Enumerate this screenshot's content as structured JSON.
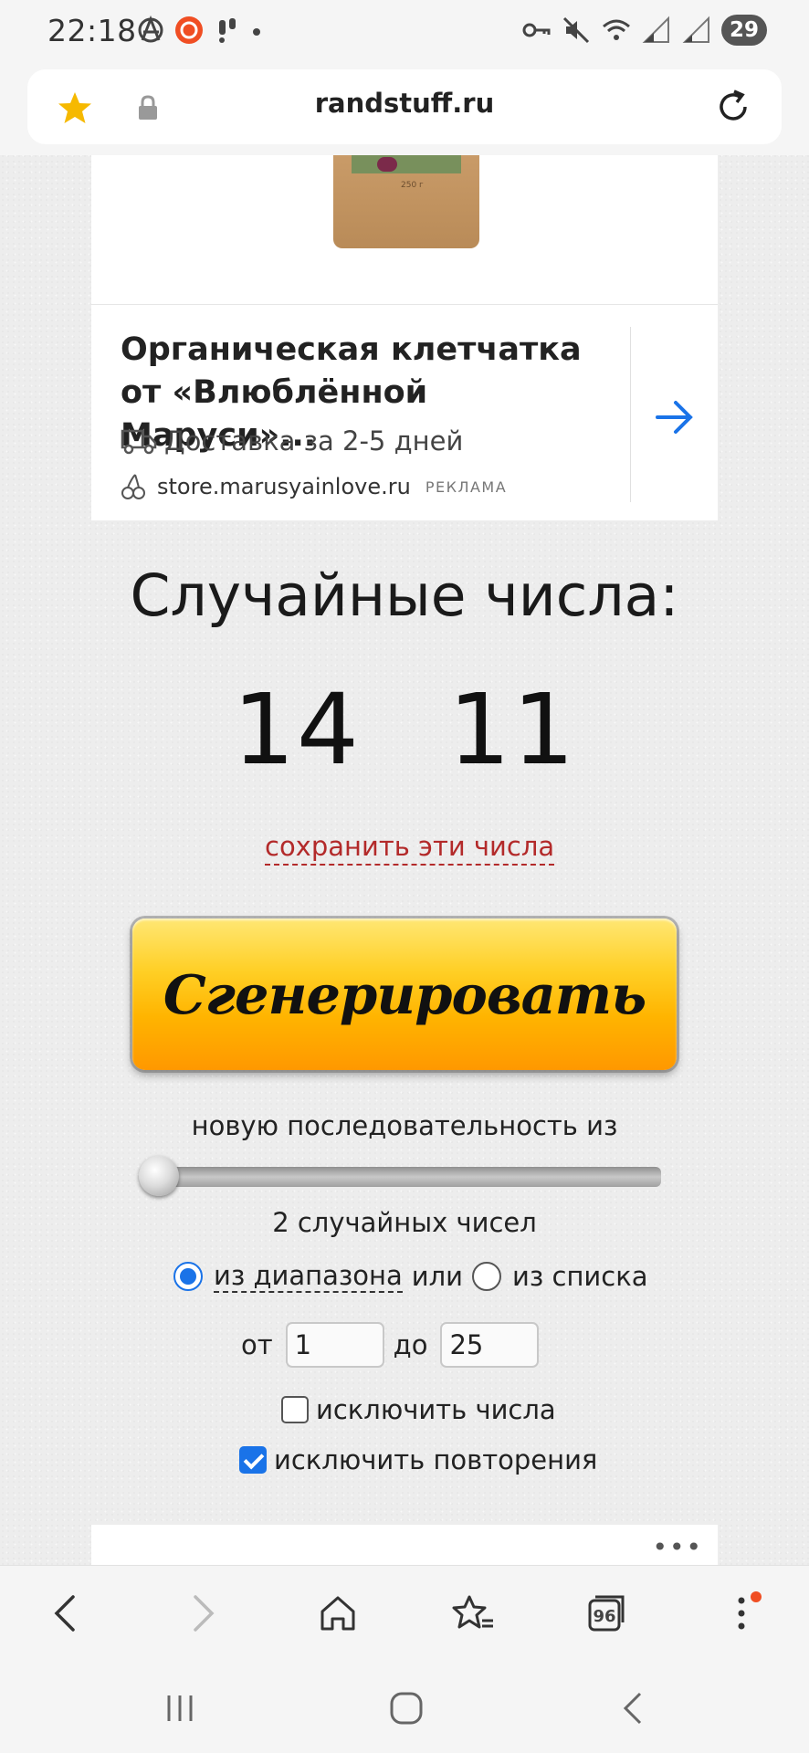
{
  "status_bar": {
    "time": "22:18",
    "battery": "29",
    "icons_left": [
      "anarchy-icon",
      "app-badge-icon",
      "notification-icon",
      "dot-icon"
    ],
    "icons_right": [
      "key-icon",
      "mute-icon",
      "wifi-icon",
      "signal-icon",
      "signal-icon",
      "battery-icon"
    ]
  },
  "browser": {
    "url": "randstuff.ru",
    "bookmarked": true,
    "tabs_count": "96"
  },
  "ad": {
    "title_line1": "Органическая клетчатка",
    "title_line2": "от «Влюблённой Маруси»...",
    "delivery": "Доставка за 2-5 дней",
    "domain": "store.marusyainlove.ru",
    "label": "РЕКЛАМА",
    "pack_text": "250 г",
    "accent_color": "#1a73e8"
  },
  "generator": {
    "heading": "Случайные числа:",
    "numbers": "14 11",
    "save_link": "сохранить эти числа",
    "button_label": "Сгенерировать",
    "sequence_text": "новую последовательность из",
    "slider_fraction": 0.0,
    "count_text": "2 случайных чисел",
    "mode_range_label": "из диапазона",
    "mode_or": "или",
    "mode_list_label": "из списка",
    "mode_selected": "range",
    "from_label": "от",
    "from_value": "1",
    "to_label": "до",
    "to_value": "25",
    "exclude_numbers_label": "исключить числа",
    "exclude_numbers_checked": false,
    "exclude_repeats_label": "исключить повторения",
    "exclude_repeats_checked": true,
    "button_color": "#ffb400"
  },
  "bottom_card": {
    "more_label": "•••"
  }
}
